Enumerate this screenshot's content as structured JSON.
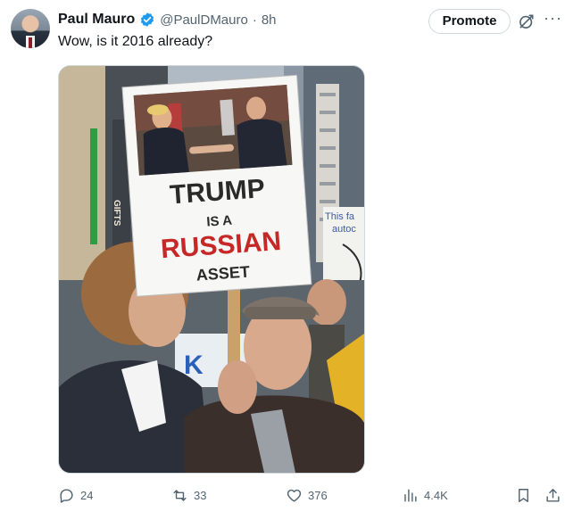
{
  "author": {
    "name": "Paul Mauro",
    "handle": "@PaulDMauro",
    "separator": "·",
    "time": "8h",
    "verified": true,
    "avatar_icon": "profile-photo"
  },
  "header_actions": {
    "promote_label": "Promote",
    "grok_icon": "grok-icon",
    "more_icon": "more-icon"
  },
  "tweet": {
    "text": "Wow, is it 2016 already?"
  },
  "media": {
    "sign_lines": [
      "TRUMP",
      "IS A",
      "RUSSIAN",
      "ASSET"
    ],
    "background_sign_lines": [
      "This fa",
      "autoc"
    ],
    "banner_text": "K",
    "store_text": "GIFTS"
  },
  "stats": {
    "replies": "24",
    "reposts": "33",
    "likes": "376",
    "views": "4.4K"
  },
  "colors": {
    "accent_verified": "#1d9bf0",
    "text_primary": "#0f1419",
    "text_secondary": "#536471",
    "sign_red": "#c62828"
  }
}
